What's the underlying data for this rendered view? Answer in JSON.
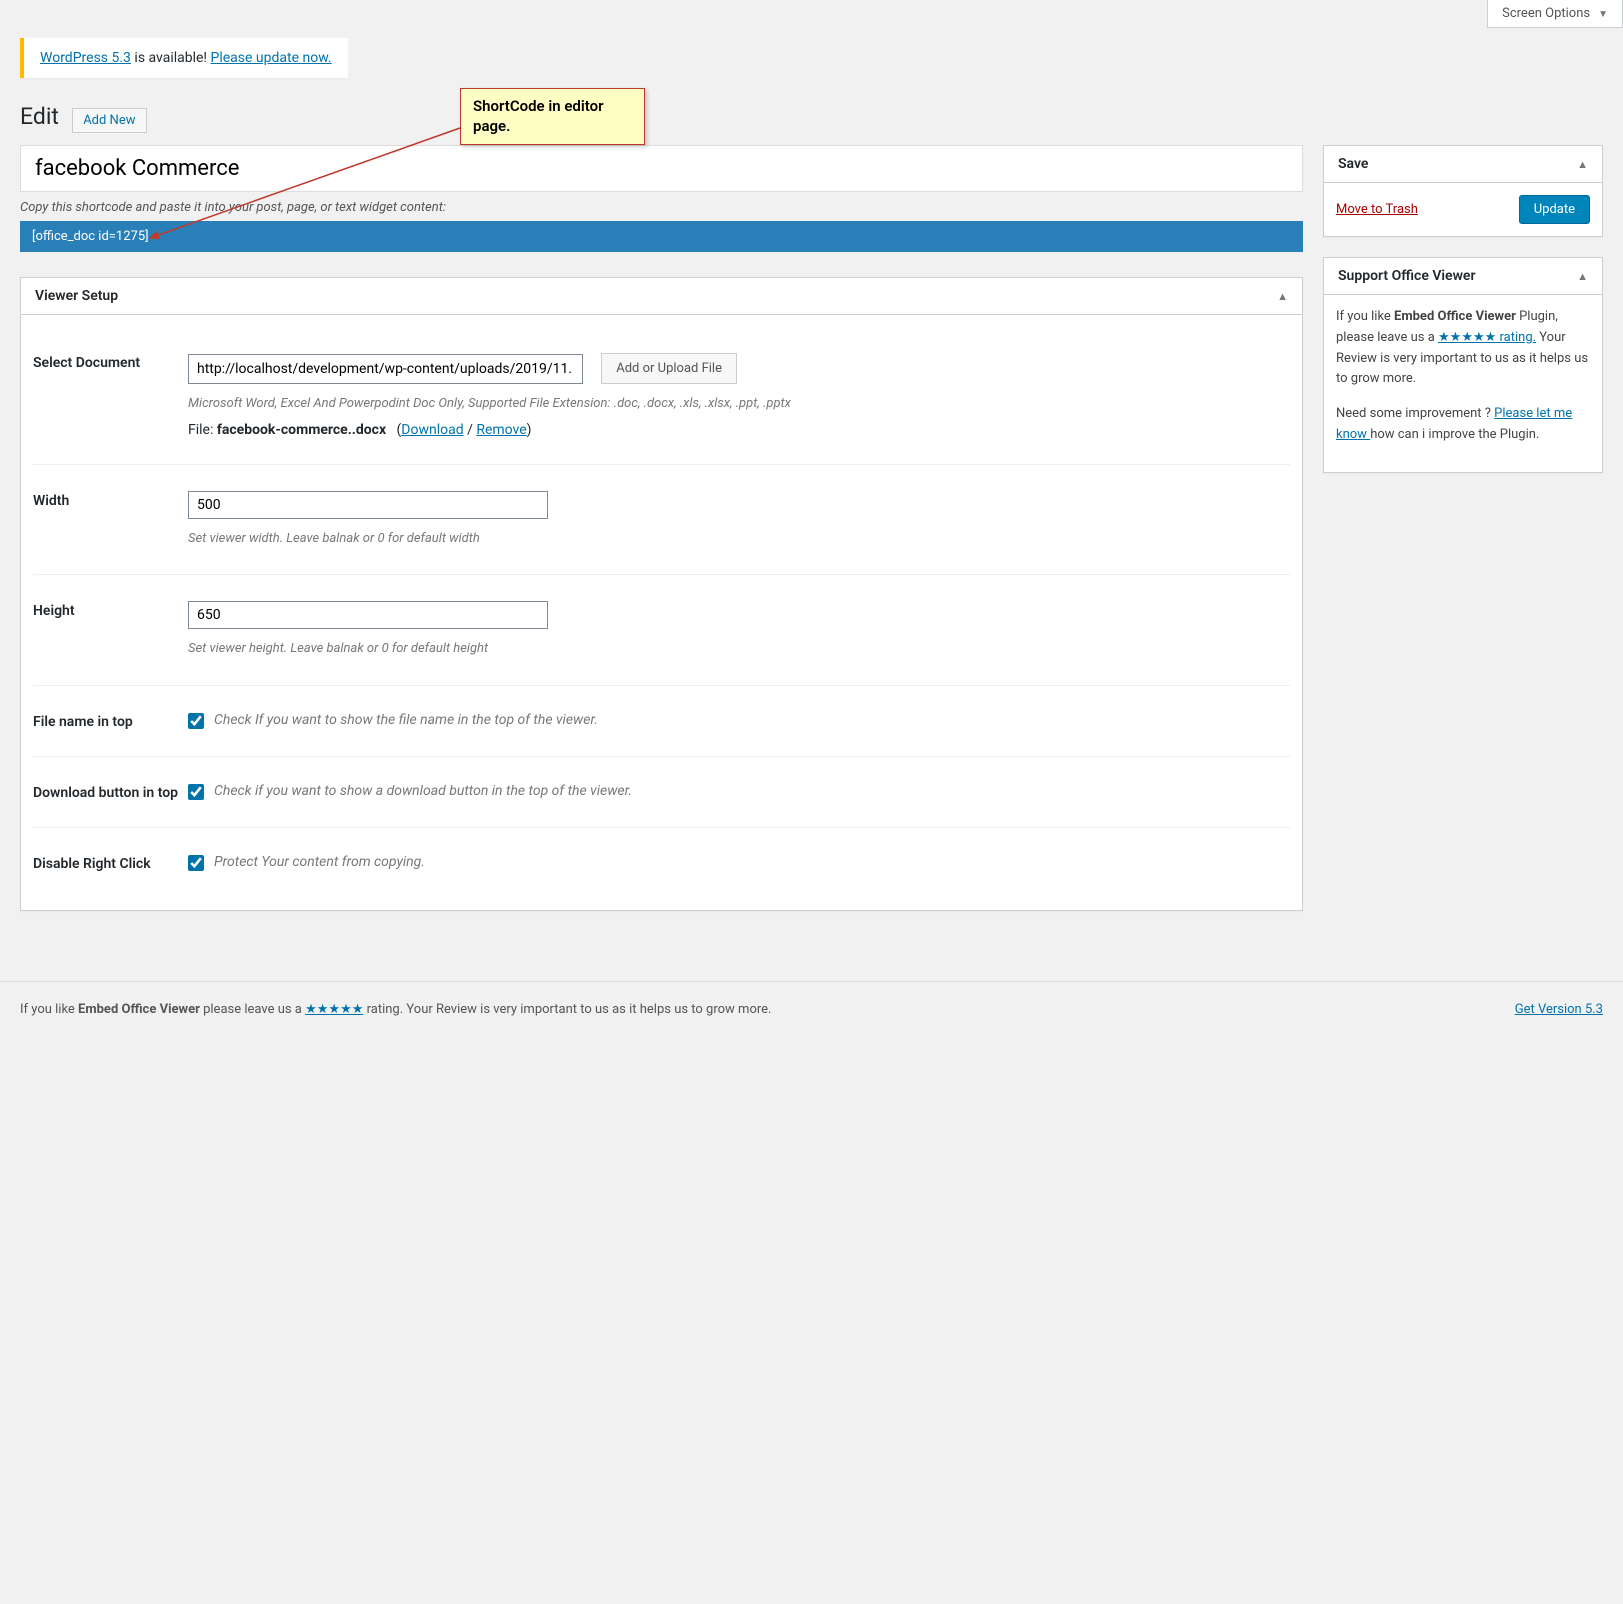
{
  "screenOptions": "Screen Options",
  "updateNag": {
    "link1": "WordPress 5.3",
    "middle": " is available! ",
    "link2": "Please update now."
  },
  "pageTitle": "Edit",
  "addNew": "Add New",
  "post": {
    "title": "facebook Commerce"
  },
  "shortcodeHint": "Copy this shortcode and paste it into your post, page, or text widget content:",
  "shortcode": "[office_doc id=1275]",
  "viewerSetup": {
    "heading": "Viewer Setup",
    "selectDocument": {
      "label": "Select Document",
      "value": "http://localhost/development/wp-content/uploads/2019/11.",
      "uploadBtn": "Add or Upload File",
      "hint": "Microsoft Word, Excel And Powerpodint Doc Only, Supported File Extension: .doc, .docx, .xls, .xlsx, .ppt, .pptx",
      "filePrefix": "File: ",
      "fileName": "facebook-commerce..docx",
      "download": "Download",
      "remove": "Remove"
    },
    "width": {
      "label": "Width",
      "value": "500",
      "hint": "Set viewer width. Leave balnak or 0 for default width"
    },
    "height": {
      "label": "Height",
      "value": "650",
      "hint": "Set viewer height. Leave balnak or 0 for default height"
    },
    "fileNameTop": {
      "label": "File name in top",
      "hint": "Check If you want to show the file name in the top of the viewer."
    },
    "downloadBtnTop": {
      "label": "Download button in top",
      "hint": "Check if you want to show a download button in the top of the viewer."
    },
    "disableRightClick": {
      "label": "Disable Right Click",
      "hint": "Protect Your content from copying."
    }
  },
  "saveBox": {
    "heading": "Save",
    "trash": "Move to Trash",
    "update": "Update"
  },
  "supportBox": {
    "heading": "Support Office Viewer",
    "p1a": "If you like ",
    "p1b": "Embed Office Viewer",
    "p1c": " Plugin, please leave us a ",
    "p1link": "★★★★★ rating.",
    "p1d": " Your Review is very important to us as it helps us to grow more.",
    "p2a": "Need some improvement ? ",
    "p2link": "Please let me know ",
    "p2b": "how can i improve the Plugin."
  },
  "footer": {
    "leftA": "If you like ",
    "leftB": "Embed Office Viewer",
    "leftC": " please leave us a ",
    "leftLink": "★★★★★",
    "leftD": " rating. Your Review is very important to us as it helps us to grow more.",
    "right": "Get Version 5.3"
  },
  "annotation": "ShortCode in editor page."
}
